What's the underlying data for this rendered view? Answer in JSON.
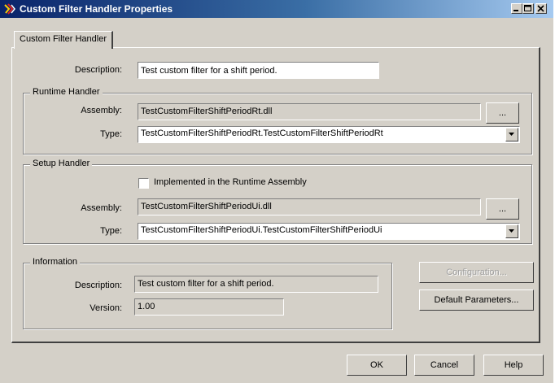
{
  "window": {
    "title": "Custom Filter Handler Properties",
    "icon": "app-icon",
    "controls": [
      "minimize-icon",
      "maximize-icon",
      "close-icon"
    ]
  },
  "tab": {
    "label": "Custom Filter Handler"
  },
  "description": {
    "label": "Description:",
    "value": "Test custom filter for a shift period."
  },
  "runtime_handler": {
    "title": "Runtime Handler",
    "assembly_label": "Assembly:",
    "assembly_value": "TestCustomFilterShiftPeriodRt.dll",
    "browse_label": "...",
    "type_label": "Type:",
    "type_value": "TestCustomFilterShiftPeriodRt.TestCustomFilterShiftPeriodRt"
  },
  "setup_handler": {
    "title": "Setup Handler",
    "checkbox_label": "Implemented in the Runtime Assembly",
    "checkbox_checked": false,
    "assembly_label": "Assembly:",
    "assembly_value": "TestCustomFilterShiftPeriodUi.dll",
    "browse_label": "...",
    "type_label": "Type:",
    "type_value": "TestCustomFilterShiftPeriodUi.TestCustomFilterShiftPeriodUi"
  },
  "information": {
    "title": "Information",
    "description_label": "Description:",
    "description_value": "Test custom filter for a shift period.",
    "version_label": "Version:",
    "version_value": "1.00"
  },
  "side_buttons": {
    "configuration": "Configuration...",
    "default_parameters": "Default Parameters..."
  },
  "footer": {
    "ok": "OK",
    "cancel": "Cancel",
    "help": "Help"
  },
  "colors": {
    "dialog_face": "#d4d0c8",
    "title_gradient_start": "#0a246a",
    "title_gradient_end": "#a6caf0",
    "disabled_text": "#a0a0a0"
  }
}
